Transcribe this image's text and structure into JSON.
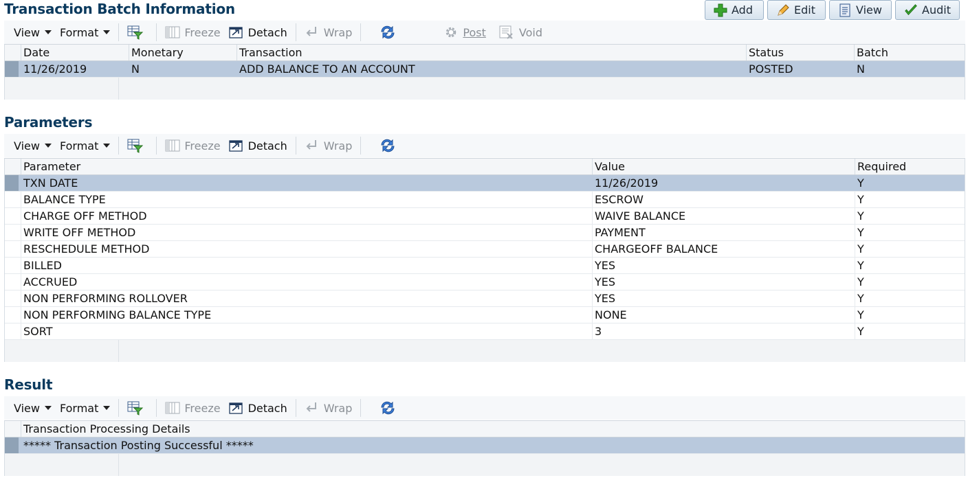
{
  "actions": [
    {
      "label": "Add",
      "icon": "plus-icon"
    },
    {
      "label": "Edit",
      "icon": "pencil-icon"
    },
    {
      "label": "View",
      "icon": "document-icon"
    },
    {
      "label": "Audit",
      "icon": "checkmark-icon"
    }
  ],
  "toolbar": {
    "view": "View",
    "format": "Format",
    "freeze": "Freeze",
    "detach": "Detach",
    "wrap": "Wrap",
    "post": "Post",
    "void": "Void"
  },
  "batch": {
    "title": "Transaction Batch Information",
    "headers": [
      "Date",
      "Monetary",
      "Transaction",
      "Status",
      "Batch"
    ],
    "rows": [
      [
        "11/26/2019",
        "N",
        "ADD BALANCE TO AN ACCOUNT",
        "POSTED",
        "N"
      ]
    ]
  },
  "parameters": {
    "title": "Parameters",
    "headers": [
      "Parameter",
      "Value",
      "Required"
    ],
    "rows": [
      [
        "TXN DATE",
        "11/26/2019",
        "Y"
      ],
      [
        "BALANCE TYPE",
        "ESCROW",
        "Y"
      ],
      [
        "CHARGE OFF METHOD",
        "WAIVE BALANCE",
        "Y"
      ],
      [
        "WRITE OFF METHOD",
        "PAYMENT",
        "Y"
      ],
      [
        "RESCHEDULE METHOD",
        "CHARGEOFF BALANCE",
        "Y"
      ],
      [
        "BILLED",
        "YES",
        "Y"
      ],
      [
        "ACCRUED",
        "YES",
        "Y"
      ],
      [
        "NON PERFORMING ROLLOVER",
        "YES",
        "Y"
      ],
      [
        "NON PERFORMING BALANCE TYPE",
        "NONE",
        "Y"
      ],
      [
        "SORT",
        "3",
        "Y"
      ]
    ]
  },
  "result": {
    "title": "Result",
    "headers": [
      "Transaction Processing Details"
    ],
    "rows": [
      [
        "***** Transaction Posting Successful *****"
      ]
    ]
  },
  "colors": {
    "title": "#0b3a5e",
    "selected_row": "#b9c9dd",
    "disabled_text": "#8a8f95"
  }
}
